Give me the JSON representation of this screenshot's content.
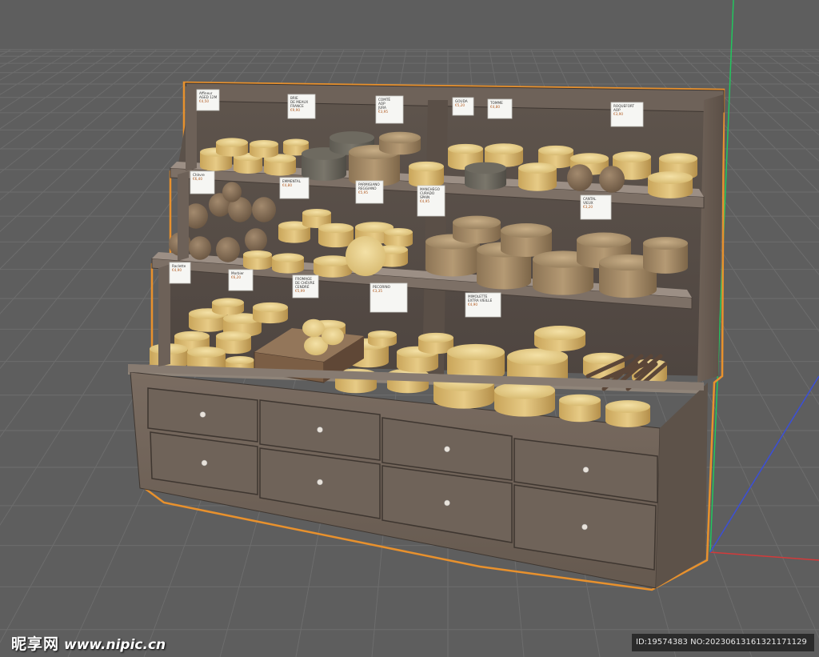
{
  "viewport": {
    "background_color": "#5e5e5e",
    "grid_color": "#6d6d6d",
    "axis_colors": {
      "y": "#22c55e",
      "x": "#d33a3a",
      "z": "#3b4fd8"
    },
    "selection_outline_color": "#e8912d"
  },
  "model": {
    "object": "cheese display cabinet",
    "labels": [
      "Affineur\nAGED 12M\n€4,50",
      "BRIE\nDE MEAUX\nFRANCE\n€9,90",
      "COMTÉ\nAOP\nJURA\n€3,95",
      "GOUDA\n€5,20",
      "TOMME\n€4,80",
      "ROQUEFORT\nAOP\n€3,90",
      "Chèvre\n€6,40",
      "EMMENTAL\n€4,80",
      "PARMIGIANO\nREGGIANO\n€5,95",
      "MANCHEGO\nCURADO\nSPAIN\n€4,95",
      "CANTAL\nVIEUX\n€3,20",
      "Raclette\n€4,90",
      "Morbier\n€6,20",
      "FROMAGE\nDE CHÈVRE\nCENDRÉ\n€5,99",
      "PECORINO\n€3,35",
      "MIMOLETTE\nEXTRA VIEILLE\n€4,90"
    ]
  },
  "watermark": {
    "brand": "昵享网",
    "url": "www.nipic.cn"
  },
  "id_bar": "ID:19574383 NO:20230613161321171129"
}
